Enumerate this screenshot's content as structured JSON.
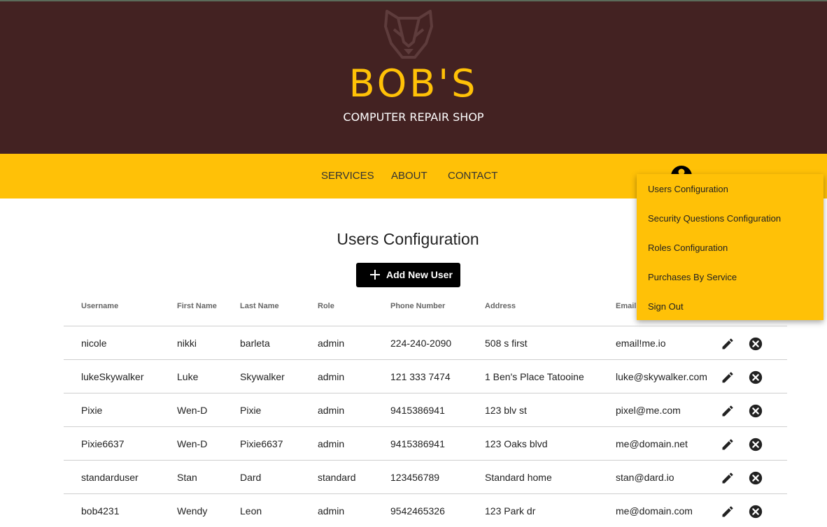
{
  "header": {
    "brand": "BOB'S",
    "tagline": "COMPUTER REPAIR SHOP",
    "logo_icon": "badger-logo-icon",
    "background": "#432222",
    "accent": "#ffc107"
  },
  "nav": {
    "services": "SERVICES",
    "about": "ABOUT",
    "contact": "CONTACT",
    "account_icon": "account-circle-icon"
  },
  "dropdown": {
    "items": [
      "Users Configuration",
      "Security Questions Configuration",
      "Roles Configuration",
      "Purchases By Service",
      "Sign Out"
    ]
  },
  "main": {
    "title": "Users Configuration",
    "add_button": "Add New User"
  },
  "table": {
    "headers": [
      "Username",
      "First Name",
      "Last Name",
      "Role",
      "Phone Number",
      "Address",
      "Email"
    ],
    "rows": [
      [
        "nicole",
        "nikki",
        "barleta",
        "admin",
        "224-240-2090",
        "508 s first",
        "email!me.io"
      ],
      [
        "lukeSkywalker",
        "Luke",
        "Skywalker",
        "admin",
        "121 333 7474",
        "1 Ben's Place Tatooine",
        "luke@skywalker.com"
      ],
      [
        "Pixie",
        "Wen-D",
        "Pixie",
        "admin",
        "9415386941",
        "123 blv st",
        "pixel@me.com"
      ],
      [
        "Pixie6637",
        "Wen-D",
        "Pixie6637",
        "admin",
        "9415386941",
        "123 Oaks blvd",
        "me@domain.net"
      ],
      [
        "standarduser",
        "Stan",
        "Dard",
        "standard",
        "123456789",
        "Standard home",
        "stan@dard.io"
      ],
      [
        "bob4231",
        "Wendy",
        "Leon",
        "admin",
        "9542465326",
        "123 Park dr",
        "me@domain.com"
      ]
    ],
    "row_icons": [
      "edit-icon",
      "delete-icon"
    ]
  }
}
